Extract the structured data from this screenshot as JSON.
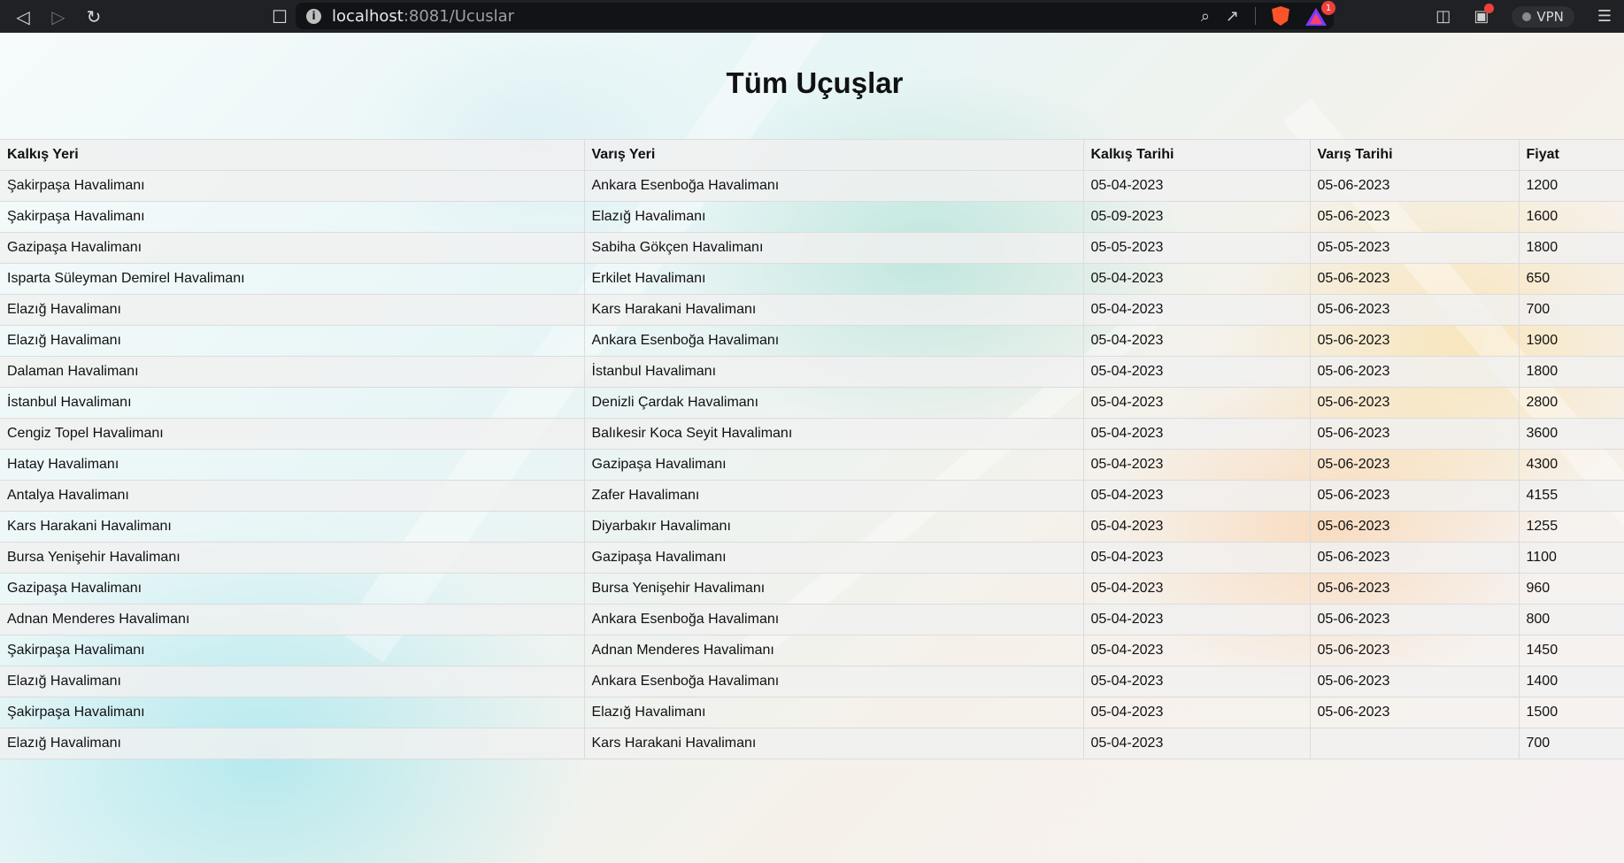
{
  "browser": {
    "url_host": "localhost",
    "url_path": ":8081/Ucuslar",
    "rewards_badge": "1",
    "vpn_label": "VPN"
  },
  "page": {
    "title": "Tüm Uçuşlar"
  },
  "table": {
    "headers": [
      "Kalkış Yeri",
      "Varış Yeri",
      "Kalkış Tarihi",
      "Varış Tarihi",
      "Fiyat"
    ],
    "rows": [
      [
        "Şakirpaşa Havalimanı",
        "Ankara Esenboğa Havalimanı",
        "05-04-2023",
        "05-06-2023",
        "1200"
      ],
      [
        "Şakirpaşa Havalimanı",
        "Elazığ Havalimanı",
        "05-09-2023",
        "05-06-2023",
        "1600"
      ],
      [
        "Gazipaşa Havalimanı",
        "Sabiha Gökçen Havalimanı",
        "05-05-2023",
        "05-05-2023",
        "1800"
      ],
      [
        "Isparta Süleyman Demirel Havalimanı",
        "Erkilet Havalimanı",
        "05-04-2023",
        "05-06-2023",
        "650"
      ],
      [
        "Elazığ Havalimanı",
        "Kars Harakani Havalimanı",
        "05-04-2023",
        "05-06-2023",
        "700"
      ],
      [
        "Elazığ Havalimanı",
        "Ankara Esenboğa Havalimanı",
        "05-04-2023",
        "05-06-2023",
        "1900"
      ],
      [
        "Dalaman Havalimanı",
        "İstanbul Havalimanı",
        "05-04-2023",
        "05-06-2023",
        "1800"
      ],
      [
        "İstanbul Havalimanı",
        "Denizli Çardak Havalimanı",
        "05-04-2023",
        "05-06-2023",
        "2800"
      ],
      [
        "Cengiz Topel Havalimanı",
        "Balıkesir Koca Seyit Havalimanı",
        "05-04-2023",
        "05-06-2023",
        "3600"
      ],
      [
        "Hatay Havalimanı",
        "Gazipaşa Havalimanı",
        "05-04-2023",
        "05-06-2023",
        "4300"
      ],
      [
        "Antalya Havalimanı",
        "Zafer Havalimanı",
        "05-04-2023",
        "05-06-2023",
        "4155"
      ],
      [
        "Kars Harakani Havalimanı",
        "Diyarbakır Havalimanı",
        "05-04-2023",
        "05-06-2023",
        "1255"
      ],
      [
        "Bursa Yenişehir Havalimanı",
        "Gazipaşa Havalimanı",
        "05-04-2023",
        "05-06-2023",
        "1100"
      ],
      [
        "Gazipaşa Havalimanı",
        "Bursa Yenişehir Havalimanı",
        "05-04-2023",
        "05-06-2023",
        "960"
      ],
      [
        "Adnan Menderes Havalimanı",
        "Ankara Esenboğa Havalimanı",
        "05-04-2023",
        "05-06-2023",
        "800"
      ],
      [
        "Şakirpaşa Havalimanı",
        "Adnan Menderes Havalimanı",
        "05-04-2023",
        "05-06-2023",
        "1450"
      ],
      [
        "Elazığ Havalimanı",
        "Ankara Esenboğa Havalimanı",
        "05-04-2023",
        "05-06-2023",
        "1400"
      ],
      [
        "Şakirpaşa Havalimanı",
        "Elazığ Havalimanı",
        "05-04-2023",
        "05-06-2023",
        "1500"
      ],
      [
        "Elazığ Havalimanı",
        "Kars Harakani Havalimanı",
        "05-04-2023",
        "",
        "700"
      ]
    ]
  }
}
